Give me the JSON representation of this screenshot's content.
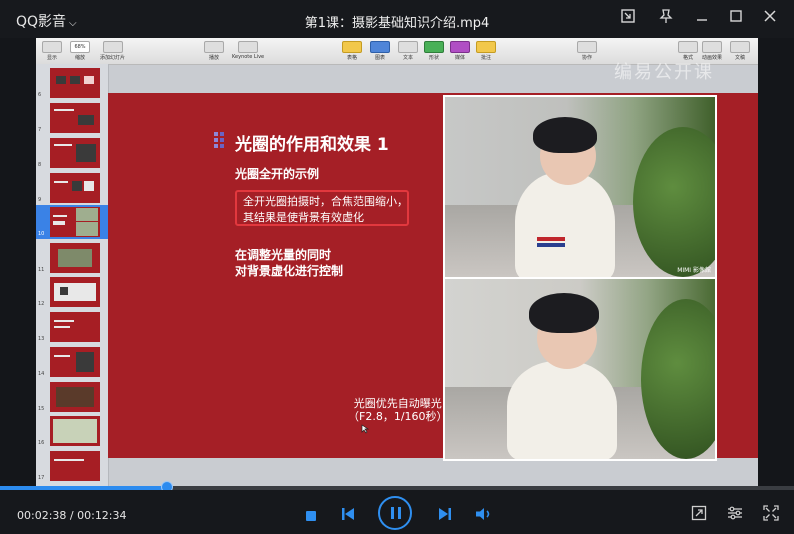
{
  "app": {
    "name": "QQ影音",
    "window_title": "第1课：摄影基础知识介绍.mp4"
  },
  "keynote": {
    "toolbar_left": [
      {
        "label": "显示"
      },
      {
        "label": "68%"
      },
      {
        "label": "添加幻灯片"
      }
    ],
    "toolbar_center": [
      {
        "label": "播放"
      },
      {
        "label": "Keynote Live"
      }
    ],
    "toolbar_insert": [
      {
        "label": "表格"
      },
      {
        "label": "图表"
      },
      {
        "label": "文本"
      },
      {
        "label": "形状"
      },
      {
        "label": "媒体"
      },
      {
        "label": "批注"
      }
    ],
    "toolbar_right": [
      {
        "label": "协作"
      },
      {
        "label": "格式"
      },
      {
        "label": "动画效果"
      },
      {
        "label": "文稿"
      }
    ],
    "zoom_sublabel": "缩放",
    "watermark": "编易公开课",
    "thumbnails": [
      "6",
      "7",
      "8",
      "9",
      "10",
      "11",
      "12",
      "13",
      "14",
      "15",
      "16",
      "17"
    ],
    "active_thumbnail": "10"
  },
  "slide": {
    "title": "光圈的作用和效果 1",
    "subtitle": "光圈全开的示例",
    "note_lines": [
      "全开光圈拍摄时，合焦范围缩小，",
      "其结果是使背景有效虚化"
    ],
    "body_lines": [
      "在调整光量的同时",
      "对背景虚化进行控制"
    ],
    "photo_credit": "MIMI 影像館",
    "caption_lines": [
      "光圈优先自动曝光",
      "（F2.8，1/160秒）"
    ]
  },
  "player": {
    "time_current": "00:02:38",
    "time_total": "00:12:34",
    "time_separator": " / ",
    "progress_fraction": 0.21,
    "accent_color": "#2c8bef"
  }
}
